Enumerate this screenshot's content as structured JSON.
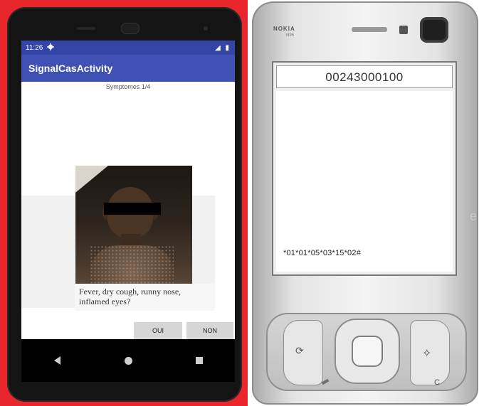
{
  "android": {
    "status_time": "11:26",
    "status_icons": "◢ ▮",
    "app_title": "SignalCasActivity",
    "progress_label": "Symptomes 1/4",
    "question": "Fever, dry cough, runny nose, inflamed eyes?",
    "buttons": {
      "yes": "OUI",
      "no": "NON"
    },
    "colors": {
      "frame": "#e8262b",
      "status_bar": "#3445a8",
      "app_bar": "#3f51b5"
    }
  },
  "nokia": {
    "brand": "NOKIA",
    "model": "N95",
    "dialed_number": "00243000100",
    "ussd_code": "*01*01*05*03*15*02#",
    "key_c": "C",
    "edge_text": "e"
  }
}
